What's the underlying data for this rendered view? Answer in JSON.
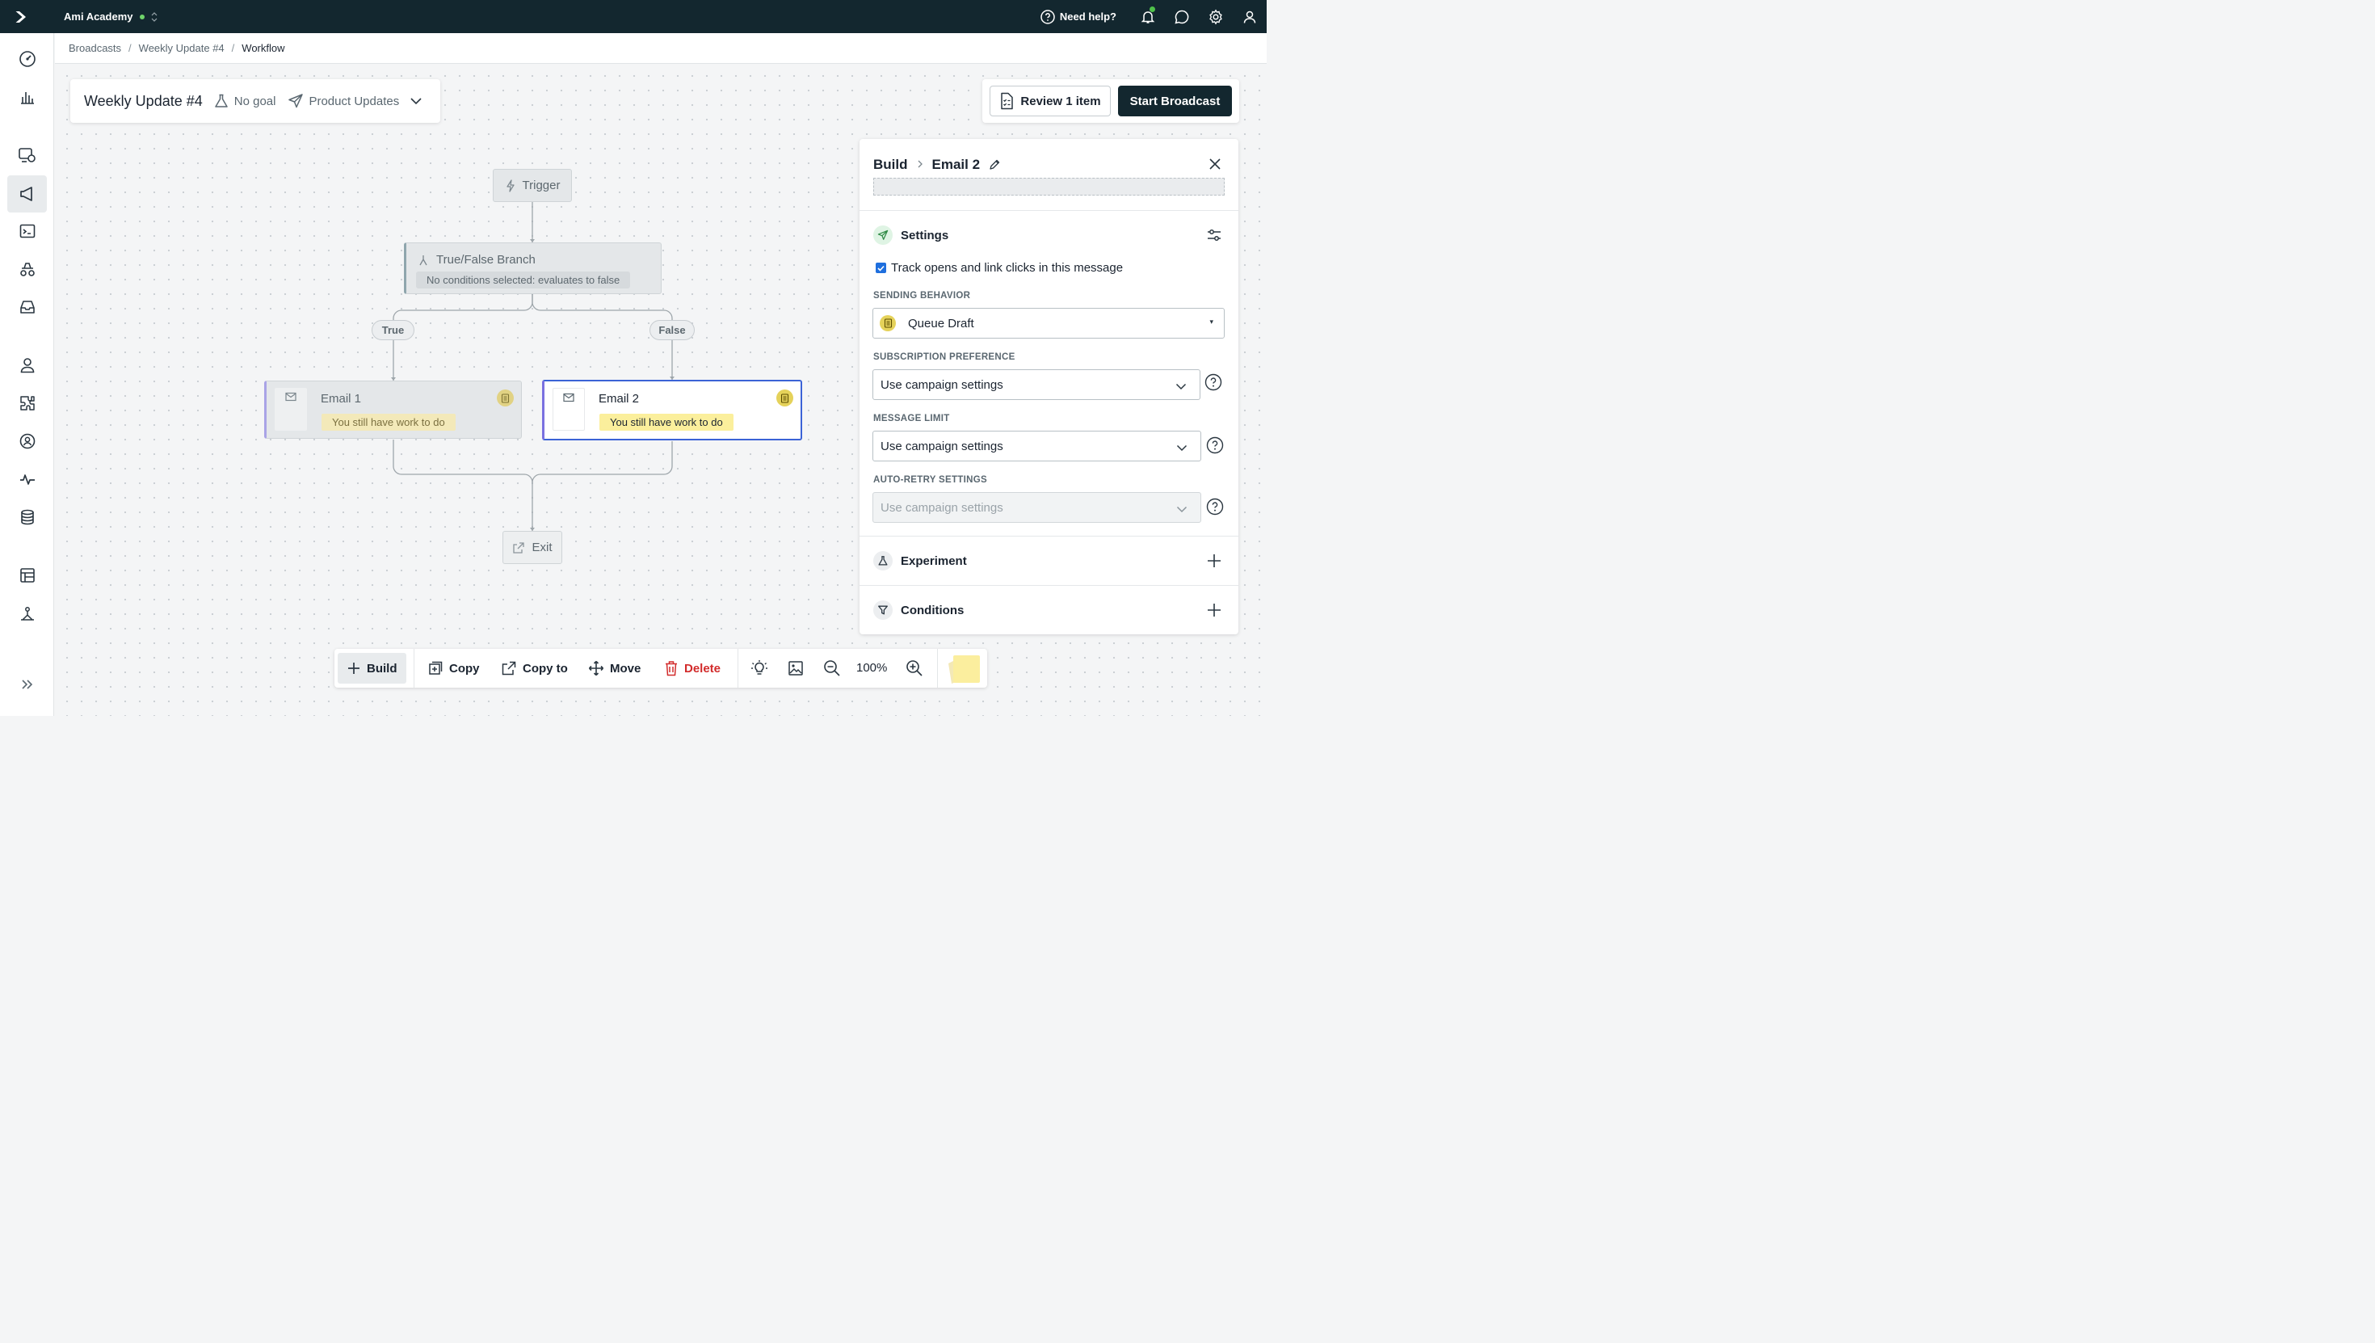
{
  "topbar": {
    "workspace": "Ami Academy",
    "help_label": "Need help?",
    "icons": [
      "logo-icon",
      "bell-icon",
      "chat-icon",
      "gear-icon",
      "user-icon"
    ]
  },
  "sidebar": {
    "items": [
      "dashboard-icon",
      "analytics-icon",
      "campaigns-icon",
      "broadcasts-icon",
      "transactional-icon",
      "journeys-icon",
      "inbox-icon",
      "people-icon",
      "integrations-icon",
      "segments-icon",
      "activity-icon",
      "data-icon",
      "content-icon",
      "objects-icon"
    ],
    "active": "broadcasts-icon",
    "expand_icon": "double-chevron-right-icon"
  },
  "breadcrumb": {
    "items": [
      "Broadcasts",
      "Weekly Update #4",
      "Workflow"
    ]
  },
  "header": {
    "title": "Weekly Update #4",
    "goal": "No goal",
    "subscription_topic": "Product Updates",
    "review_label": "Review 1 item",
    "start_label": "Start Broadcast"
  },
  "workflow": {
    "trigger": "Trigger",
    "branch": {
      "title": "True/False Branch",
      "subtitle": "No conditions selected: evaluates to false"
    },
    "true_label": "True",
    "false_label": "False",
    "email1": {
      "title": "Email 1",
      "warning": "You still have work to do"
    },
    "email2": {
      "title": "Email 2",
      "warning": "You still have work to do",
      "selected": true
    },
    "exit": "Exit"
  },
  "panel": {
    "crumb_root": "Build",
    "crumb_current": "Email 2",
    "settings_title": "Settings",
    "track_label": "Track opens and link clicks in this message",
    "track_checked": true,
    "sending_behavior_label": "SENDING BEHAVIOR",
    "sending_behavior_value": "Queue Draft",
    "subscription_pref_label": "SUBSCRIPTION PREFERENCE",
    "subscription_pref_value": "Use campaign settings",
    "message_limit_label": "MESSAGE LIMIT",
    "message_limit_value": "Use campaign settings",
    "auto_retry_label": "AUTO-RETRY SETTINGS",
    "auto_retry_value": "Use campaign settings",
    "experiment_title": "Experiment",
    "conditions_title": "Conditions"
  },
  "toolbar": {
    "build": "Build",
    "copy": "Copy",
    "copy_to": "Copy to",
    "move": "Move",
    "delete": "Delete",
    "zoom": "100%"
  },
  "colors": {
    "topbar": "#13272f",
    "primary_button": "#13272f",
    "selection": "#3b63d6",
    "danger": "#d22b2b",
    "warning_bg": "#fbef9c",
    "draft_badge": "#e5d25a"
  }
}
